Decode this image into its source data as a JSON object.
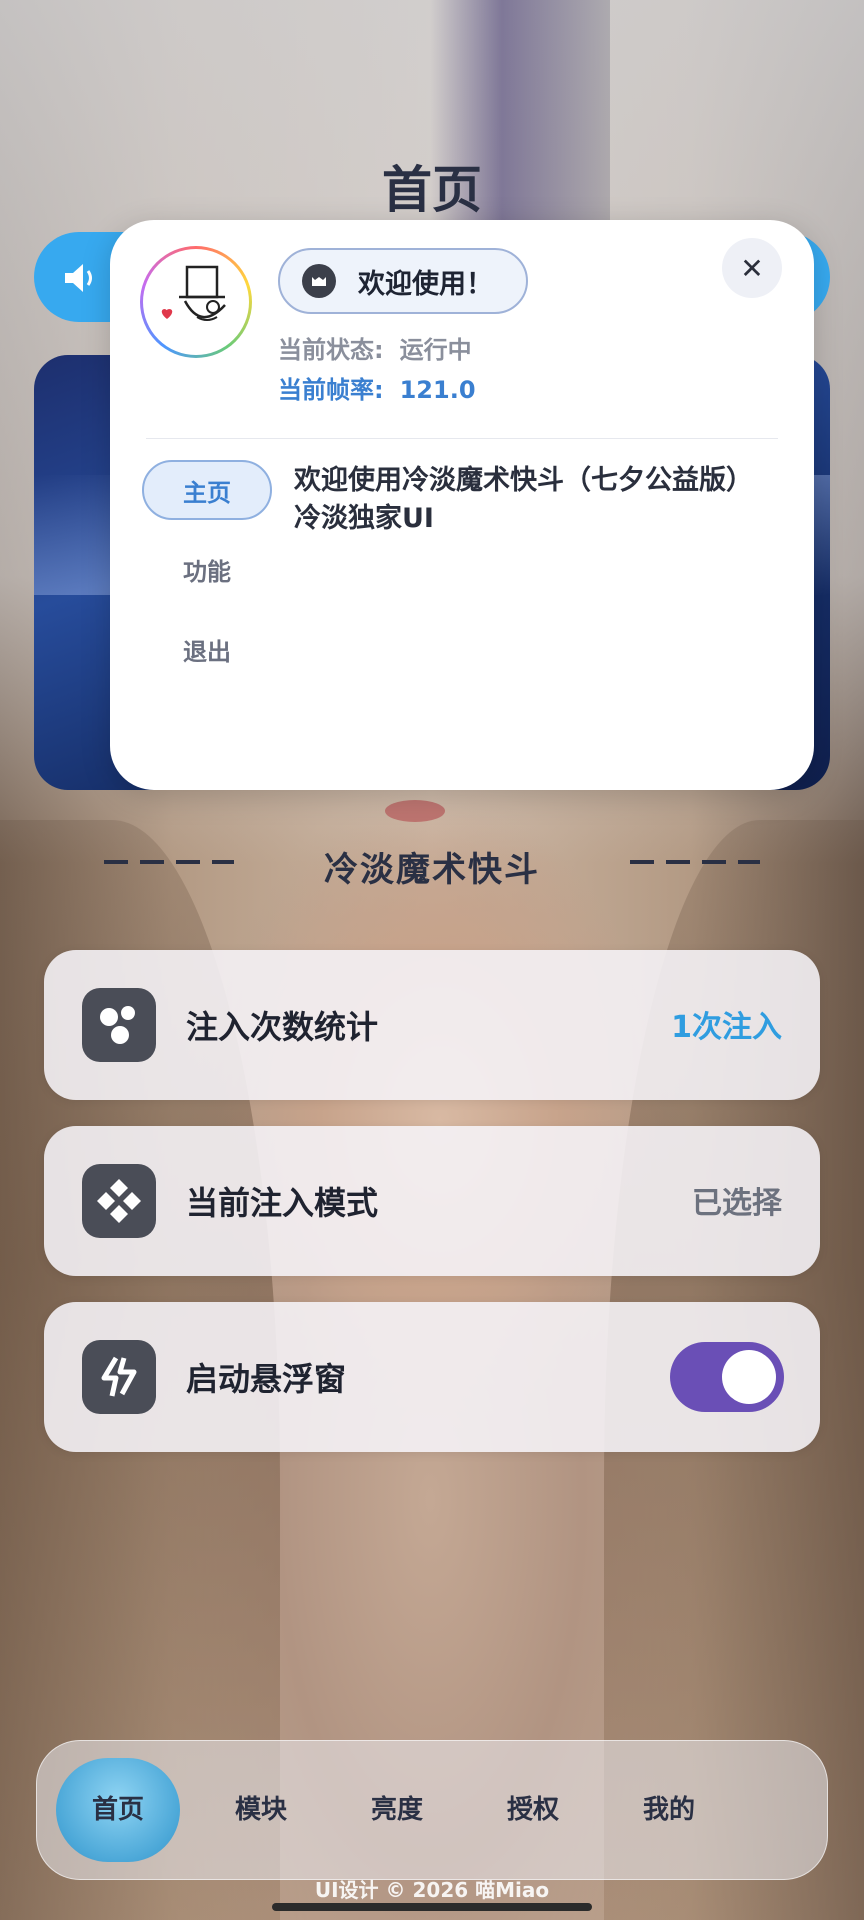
{
  "header": {
    "title": "首页"
  },
  "popup": {
    "welcome": "欢迎使用！",
    "status_label": "当前状态:",
    "status_value": "运行中",
    "fps_label": "当前帧率:",
    "fps_value": "121.0",
    "nav": [
      {
        "label": "主页",
        "active": true
      },
      {
        "label": "功能",
        "active": false
      },
      {
        "label": "退出",
        "active": false
      }
    ],
    "content": "欢迎使用冷淡魔术快斗（七夕公益版）冷淡独家UI",
    "close_icon": "close-icon"
  },
  "section": {
    "title": "冷淡魔术快斗"
  },
  "cards": [
    {
      "label": "注入次数统计",
      "value": "1次注入",
      "icon": "dots-icon"
    },
    {
      "label": "当前注入模式",
      "value": "已选择",
      "icon": "diamond-logo-icon"
    },
    {
      "label": "启动悬浮窗",
      "toggle_on": true,
      "icon": "bolt-icon"
    }
  ],
  "tabs": [
    {
      "label": "首页",
      "active": true
    },
    {
      "label": "模块",
      "active": false
    },
    {
      "label": "亮度",
      "active": false
    },
    {
      "label": "授权",
      "active": false
    },
    {
      "label": "我的",
      "active": false
    }
  ],
  "footer": "UI设计 © 2026 喵Miao",
  "colors": {
    "accent_blue": "#37a9ef",
    "toggle_purple": "#6a4fb6",
    "value_blue": "#2f9de0"
  }
}
